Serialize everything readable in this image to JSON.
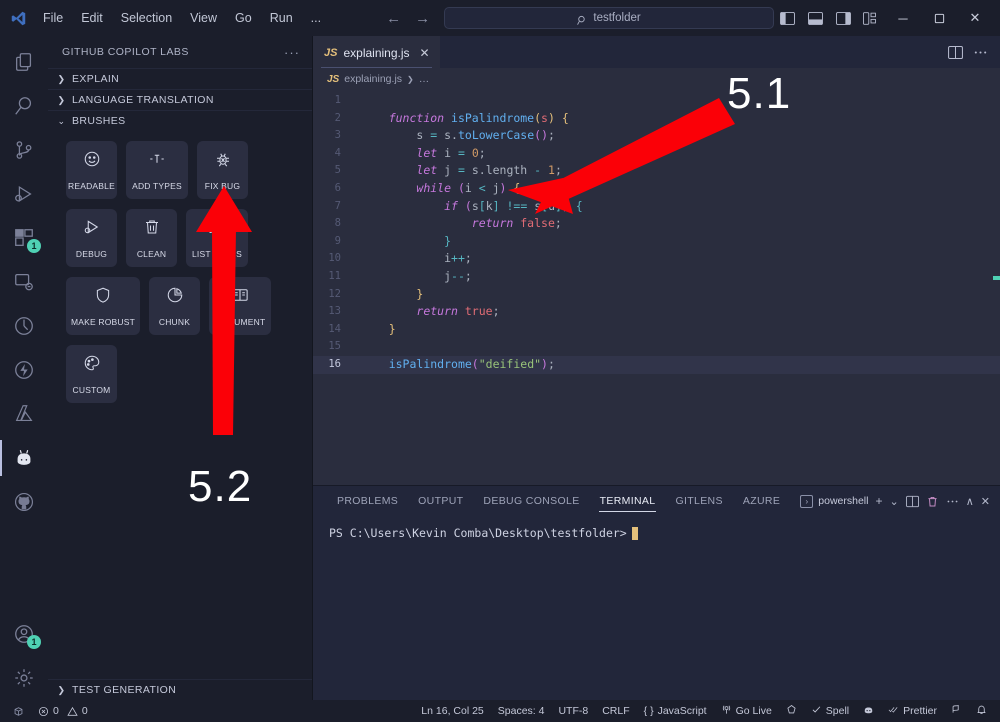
{
  "titlebar": {
    "logo": "vscode-logo",
    "menu": [
      "File",
      "Edit",
      "Selection",
      "View",
      "Go",
      "Run",
      "..."
    ],
    "nav_back": "←",
    "nav_forward": "→",
    "search_value": "testfolder",
    "search_placeholder": "Search",
    "layout_icons": [
      "toggle-primary-sidebar",
      "toggle-panel",
      "toggle-secondary-sidebar",
      "customize-layout"
    ],
    "window_minimize": "─",
    "window_restore": "☐",
    "window_close": "✕"
  },
  "activitybar": {
    "items": [
      {
        "name": "explorer",
        "badge": ""
      },
      {
        "name": "search",
        "badge": ""
      },
      {
        "name": "source-control",
        "badge": ""
      },
      {
        "name": "run-and-debug",
        "badge": ""
      },
      {
        "name": "extensions",
        "badge": "1"
      },
      {
        "name": "remote-explorer",
        "badge": ""
      },
      {
        "name": "testing",
        "badge": ""
      },
      {
        "name": "thunder-client",
        "badge": ""
      },
      {
        "name": "azure",
        "badge": ""
      },
      {
        "name": "copilot-labs",
        "badge": ""
      },
      {
        "name": "github",
        "badge": ""
      }
    ],
    "bottom": [
      {
        "name": "accounts",
        "badge": "1"
      },
      {
        "name": "settings",
        "badge": ""
      }
    ]
  },
  "sidebar": {
    "title": "GITHUB COPILOT LABS",
    "more_actions": "···",
    "sections": [
      {
        "label": "EXPLAIN",
        "expanded": false,
        "chevron": "❯"
      },
      {
        "label": "LANGUAGE TRANSLATION",
        "expanded": false,
        "chevron": "❯"
      },
      {
        "label": "BRUSHES",
        "expanded": true,
        "chevron": "⌄"
      }
    ],
    "brushes": [
      {
        "label": "READABLE",
        "icon": "smiley-icon"
      },
      {
        "label": "ADD TYPES",
        "icon": "types-icon"
      },
      {
        "label": "FIX BUG",
        "icon": "bug-icon"
      },
      {
        "label": "DEBUG",
        "icon": "debug-icon"
      },
      {
        "label": "CLEAN",
        "icon": "trash-icon"
      },
      {
        "label": "LIST STEPS",
        "icon": "list-icon"
      },
      {
        "label": "MAKE ROBUST",
        "icon": "shield-icon"
      },
      {
        "label": "CHUNK",
        "icon": "piechart-icon"
      },
      {
        "label": "DOCUMENT",
        "icon": "book-icon"
      },
      {
        "label": "CUSTOM",
        "icon": "palette-icon"
      }
    ],
    "footer_section": {
      "label": "TEST GENERATION",
      "chevron": "❯"
    }
  },
  "editor": {
    "tab": {
      "icon_label": "JS",
      "filename": "explaining.js",
      "close": "✕"
    },
    "actions": [
      "split-editor",
      "more-actions"
    ],
    "breadcrumb": {
      "icon_label": "JS",
      "file": "explaining.js",
      "separator": "❯",
      "trail": "…"
    },
    "active_line": 16,
    "lines": [
      {
        "n": 1,
        "tokens": []
      },
      {
        "n": 2,
        "tokens": [
          {
            "t": "    ",
            "c": "pl"
          },
          {
            "t": "function ",
            "c": "kw"
          },
          {
            "t": "isPalindrome",
            "c": "fn"
          },
          {
            "t": "(",
            "c": "br"
          },
          {
            "t": "s",
            "c": "pr"
          },
          {
            "t": ") ",
            "c": "br"
          },
          {
            "t": "{",
            "c": "br"
          }
        ]
      },
      {
        "n": 3,
        "tokens": [
          {
            "t": "        ",
            "c": "pl"
          },
          {
            "t": "s",
            "c": "pl"
          },
          {
            "t": " = ",
            "c": "op"
          },
          {
            "t": "s",
            "c": "pl"
          },
          {
            "t": ".",
            "c": "pl"
          },
          {
            "t": "toLowerCase",
            "c": "fn"
          },
          {
            "t": "()",
            "c": "br2"
          },
          {
            "t": ";",
            "c": "pl"
          }
        ]
      },
      {
        "n": 4,
        "tokens": [
          {
            "t": "        ",
            "c": "pl"
          },
          {
            "t": "let ",
            "c": "kw"
          },
          {
            "t": "i",
            "c": "pl"
          },
          {
            "t": " = ",
            "c": "op"
          },
          {
            "t": "0",
            "c": "num"
          },
          {
            "t": ";",
            "c": "pl"
          }
        ]
      },
      {
        "n": 5,
        "tokens": [
          {
            "t": "        ",
            "c": "pl"
          },
          {
            "t": "let ",
            "c": "kw"
          },
          {
            "t": "j",
            "c": "pl"
          },
          {
            "t": " = ",
            "c": "op"
          },
          {
            "t": "s",
            "c": "pl"
          },
          {
            "t": ".",
            "c": "pl"
          },
          {
            "t": "length",
            "c": "pl"
          },
          {
            "t": " - ",
            "c": "op"
          },
          {
            "t": "1",
            "c": "num"
          },
          {
            "t": ";",
            "c": "pl"
          }
        ]
      },
      {
        "n": 6,
        "tokens": [
          {
            "t": "        ",
            "c": "pl"
          },
          {
            "t": "while ",
            "c": "kw"
          },
          {
            "t": "(",
            "c": "br2"
          },
          {
            "t": "i ",
            "c": "pl"
          },
          {
            "t": "< ",
            "c": "op"
          },
          {
            "t": "j",
            "c": "pl"
          },
          {
            "t": ") ",
            "c": "br2"
          },
          {
            "t": "{",
            "c": "br"
          }
        ]
      },
      {
        "n": 7,
        "tokens": [
          {
            "t": "            ",
            "c": "pl"
          },
          {
            "t": "if ",
            "c": "kw"
          },
          {
            "t": "(",
            "c": "br2"
          },
          {
            "t": "s",
            "c": "pl"
          },
          {
            "t": "[",
            "c": "br3"
          },
          {
            "t": "k",
            "c": "pl"
          },
          {
            "t": "] ",
            "c": "br3"
          },
          {
            "t": "!== ",
            "c": "op"
          },
          {
            "t": "s",
            "c": "pl"
          },
          {
            "t": "[",
            "c": "br3"
          },
          {
            "t": "u",
            "c": "pl"
          },
          {
            "t": "]",
            "c": "br3"
          },
          {
            "t": ") ",
            "c": "br2"
          },
          {
            "t": "{",
            "c": "br3"
          }
        ]
      },
      {
        "n": 8,
        "tokens": [
          {
            "t": "                ",
            "c": "pl"
          },
          {
            "t": "return ",
            "c": "kw"
          },
          {
            "t": "false",
            "c": "pr"
          },
          {
            "t": ";",
            "c": "pl"
          }
        ]
      },
      {
        "n": 9,
        "tokens": [
          {
            "t": "            ",
            "c": "pl"
          },
          {
            "t": "}",
            "c": "br3"
          }
        ]
      },
      {
        "n": 10,
        "tokens": [
          {
            "t": "            ",
            "c": "pl"
          },
          {
            "t": "i",
            "c": "pl"
          },
          {
            "t": "++",
            "c": "op"
          },
          {
            "t": ";",
            "c": "pl"
          }
        ]
      },
      {
        "n": 11,
        "tokens": [
          {
            "t": "            ",
            "c": "pl"
          },
          {
            "t": "j",
            "c": "pl"
          },
          {
            "t": "--",
            "c": "op"
          },
          {
            "t": ";",
            "c": "pl"
          }
        ]
      },
      {
        "n": 12,
        "tokens": [
          {
            "t": "        ",
            "c": "pl"
          },
          {
            "t": "}",
            "c": "br"
          }
        ]
      },
      {
        "n": 13,
        "tokens": [
          {
            "t": "        ",
            "c": "pl"
          },
          {
            "t": "return ",
            "c": "kw"
          },
          {
            "t": "true",
            "c": "pr"
          },
          {
            "t": ";",
            "c": "pl"
          }
        ]
      },
      {
        "n": 14,
        "tokens": [
          {
            "t": "    ",
            "c": "pl"
          },
          {
            "t": "}",
            "c": "br"
          }
        ]
      },
      {
        "n": 15,
        "tokens": []
      },
      {
        "n": 16,
        "tokens": [
          {
            "t": "    ",
            "c": "pl"
          },
          {
            "t": "isPalindrome",
            "c": "fn"
          },
          {
            "t": "(",
            "c": "br2"
          },
          {
            "t": "\"deified\"",
            "c": "str"
          },
          {
            "t": ")",
            "c": "br2"
          },
          {
            "t": ";",
            "c": "pl"
          }
        ]
      }
    ]
  },
  "panel": {
    "tabs": [
      {
        "label": "PROBLEMS",
        "active": false
      },
      {
        "label": "OUTPUT",
        "active": false
      },
      {
        "label": "DEBUG CONSOLE",
        "active": false
      },
      {
        "label": "TERMINAL",
        "active": true
      },
      {
        "label": "GITLENS",
        "active": false
      },
      {
        "label": "AZURE",
        "active": false
      }
    ],
    "shell": {
      "label": "powershell",
      "chevron": "❯"
    },
    "actions": [
      "new-terminal",
      "split-terminal",
      "kill-terminal",
      "more-actions",
      "maximize-panel",
      "close-panel"
    ],
    "add": "+",
    "dropdown": "⌄",
    "maximize": "∧",
    "close": "✕",
    "terminal_prompt": "PS C:\\Users\\Kevin Comba\\Desktop\\testfolder>"
  },
  "statusbar": {
    "remote_icon": "remote-window-icon",
    "errors": "0",
    "warnings": "0",
    "right_items": [
      {
        "label": "Ln 16, Col 25",
        "icon": ""
      },
      {
        "label": "Spaces: 4",
        "icon": ""
      },
      {
        "label": "UTF-8",
        "icon": ""
      },
      {
        "label": "CRLF",
        "icon": ""
      },
      {
        "label": "JavaScript",
        "icon": "braces-icon"
      },
      {
        "label": "Go Live",
        "icon": "broadcast-icon"
      },
      {
        "label": "",
        "icon": "gitlens-icon"
      },
      {
        "label": "Spell",
        "icon": "check-icon"
      },
      {
        "label": "",
        "icon": "smiley-icon"
      },
      {
        "label": "Prettier",
        "icon": "doublecheck-icon"
      },
      {
        "label": "",
        "icon": "feedback-icon"
      },
      {
        "label": "",
        "icon": "bell-icon"
      }
    ]
  },
  "annotations": [
    {
      "label": "5.1",
      "target": "code-line-7",
      "color": "#fb0007"
    },
    {
      "label": "5.2",
      "target": "fix-bug-brush",
      "color": "#fb0007"
    }
  ],
  "colors": {
    "accent_red": "#fb0007",
    "editor_bg": "#2a2d3e",
    "sidebar_bg": "#1b1e2b",
    "panel_bg": "#22263a",
    "badge_green": "#4fd1b4"
  }
}
